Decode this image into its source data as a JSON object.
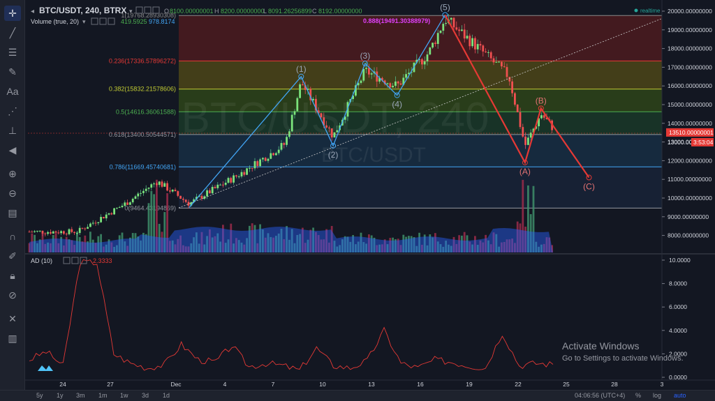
{
  "header": {
    "symbol": "BTC/USDT, 240, BTRX",
    "ohlc": [
      {
        "k": "O",
        "v": "8100.00000001"
      },
      {
        "k": "H",
        "v": "8200.00000000"
      },
      {
        "k": "L",
        "v": "8091.26256899"
      },
      {
        "k": "C",
        "v": "8192.00000000"
      }
    ],
    "volume_label": "Volume (true, 20)",
    "volume_values": [
      "419.5925",
      "978.8174"
    ],
    "realtime": "realtime",
    "watermark_big": "BTC/USDT, 240",
    "watermark_small": "BTC/USDT"
  },
  "ad_indicator": {
    "label": "AD (10)",
    "value": "2.3333"
  },
  "price_axis": {
    "ticks": [
      "20000.00000000",
      "19000.00000000",
      "18000.00000000",
      "17000.00000000",
      "16000.00000000",
      "15000.00000000",
      "14000.00000000",
      "13000.00000000",
      "12000.00000000",
      "11000.00000000",
      "10000.00000000",
      "9000.00000000",
      "8000.00000000"
    ],
    "last_price": "13510.00000001",
    "countdown": "3:53:04",
    "crosshair_price": "13000.00"
  },
  "ad_axis": {
    "ticks": [
      "10.0000",
      "8.0000",
      "6.0000",
      "4.0000",
      "2.0000",
      "0.0000"
    ]
  },
  "time_axis": {
    "ticks": [
      "24",
      "27",
      "Dec",
      "4",
      "7",
      "10",
      "13",
      "16",
      "19",
      "22",
      "25",
      "28",
      "3"
    ]
  },
  "fib_levels": [
    {
      "label": "1(19768.28930308)",
      "price": 19768.2893,
      "color": "#8a8a8a"
    },
    {
      "label": "0.236(17336.57896272)",
      "price": 17336.579,
      "color": "#e53935"
    },
    {
      "label": "0.382(15832.21578606)",
      "price": 15832.2158,
      "color": "#c0ca33"
    },
    {
      "label": "0.5(14616.36061588)",
      "price": 14616.3606,
      "color": "#4caf50"
    },
    {
      "label": "0.618(13400.50544571)",
      "price": 13400.5054,
      "color": "#9598a1"
    },
    {
      "label": "0.786(11669.45740681)",
      "price": 11669.4574,
      "color": "#42a5f5"
    },
    {
      "label": "0(9464.43194869)",
      "price": 9464.4319,
      "color": "#9598a1"
    }
  ],
  "fib_extra_label": "0.888(19491.30388979)",
  "elliott_impulse": [
    {
      "label": "",
      "date": "Dec 1",
      "price": 9500
    },
    {
      "label": "(1)",
      "date": "Dec 8",
      "price": 16500
    },
    {
      "label": "(2)",
      "date": "Dec 10",
      "price": 12800
    },
    {
      "label": "(3)",
      "date": "Dec 12",
      "price": 17200
    },
    {
      "label": "(4)",
      "date": "Dec 14",
      "price": 15500
    },
    {
      "label": "(5)",
      "date": "Dec 17",
      "price": 19800
    }
  ],
  "elliott_correction": [
    {
      "label": "",
      "date": "Dec 17",
      "price": 19800
    },
    {
      "label": "(A)",
      "date": "Dec 22",
      "price": 11900
    },
    {
      "label": "(B)",
      "date": "Dec 23",
      "price": 14800
    },
    {
      "label": "(C)",
      "date": "Dec 26",
      "price": 11100
    }
  ],
  "timeframes": [
    "5y",
    "1y",
    "3m",
    "1m",
    "1w",
    "3d",
    "1d"
  ],
  "clock": "04:06:56 (UTC+4)",
  "scale_buttons": [
    {
      "label": "%",
      "on": false
    },
    {
      "label": "log",
      "on": false
    },
    {
      "label": "auto",
      "on": true
    }
  ],
  "activate_windows": {
    "line1": "Activate Windows",
    "line2": "Go to Settings to activate Windows."
  },
  "chart_data": {
    "type": "candlestick",
    "title": "BTC/USDT, 240, BTRX",
    "ylim": [
      7500,
      20100
    ],
    "close_approx": [
      {
        "date": "Nov 21",
        "close": 8200
      },
      {
        "date": "Nov 24",
        "close": 8200
      },
      {
        "date": "Nov 27",
        "close": 9700
      },
      {
        "date": "Nov 29",
        "close": 10900
      },
      {
        "date": "Dec 1",
        "close": 9700
      },
      {
        "date": "Dec 4",
        "close": 11200
      },
      {
        "date": "Dec 7",
        "close": 12900
      },
      {
        "date": "Dec 8",
        "close": 16200
      },
      {
        "date": "Dec 10",
        "close": 13300
      },
      {
        "date": "Dec 12",
        "close": 16800
      },
      {
        "date": "Dec 14",
        "close": 16000
      },
      {
        "date": "Dec 16",
        "close": 17800
      },
      {
        "date": "Dec 17",
        "close": 19600
      },
      {
        "date": "Dec 19",
        "close": 18100
      },
      {
        "date": "Dec 21",
        "close": 16500
      },
      {
        "date": "Dec 22",
        "close": 12800
      },
      {
        "date": "Dec 23",
        "close": 14500
      },
      {
        "date": "Dec 24",
        "close": 13510
      }
    ],
    "ad_indicator_approx": [
      1.5,
      2.2,
      1.0,
      9.8,
      9.8,
      2.0,
      1.2,
      0.8,
      1.1,
      2.8,
      1.5,
      1.3,
      2.7,
      0.9,
      1.2,
      1.0,
      0.6,
      2.5,
      1.0,
      0.8,
      1.4,
      4.0,
      1.2,
      0.8,
      1.5,
      1.3,
      1.0,
      0.8,
      3.8,
      1.0,
      1.2,
      1.1
    ]
  }
}
